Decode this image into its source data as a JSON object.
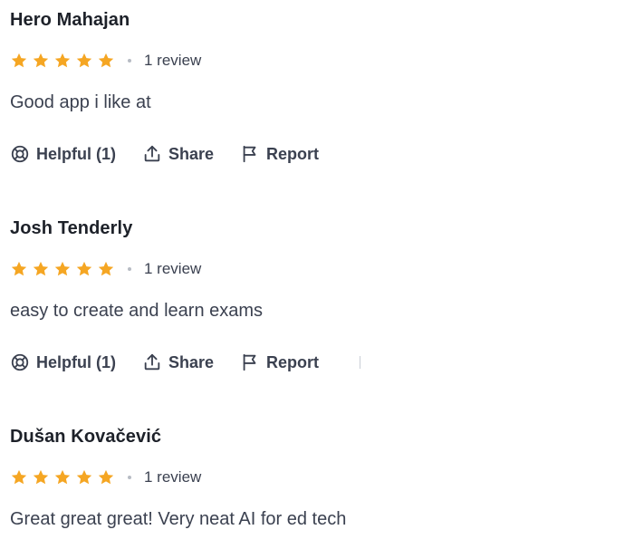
{
  "colors": {
    "star": "#f5a623",
    "text": "#3b4150",
    "name": "#1d2129"
  },
  "reviews": [
    {
      "name": "Hero Mahajan",
      "rating": 5,
      "review_count": "1 review",
      "text": "Good app i like at",
      "actions": {
        "helpful": "Helpful (1)",
        "share": "Share",
        "report": "Report"
      }
    },
    {
      "name": "Josh Tenderly",
      "rating": 5,
      "review_count": "1 review",
      "text": "easy to create and learn exams",
      "actions": {
        "helpful": "Helpful (1)",
        "share": "Share",
        "report": "Report"
      }
    },
    {
      "name": "Dušan Kovačević",
      "rating": 5,
      "review_count": "1 review",
      "text": "Great great great! Very neat AI for ed tech"
    }
  ],
  "icons": {
    "helpful": "lifebuoy-icon",
    "share": "share-upload-icon",
    "report": "flag-icon",
    "star": "star-icon"
  }
}
